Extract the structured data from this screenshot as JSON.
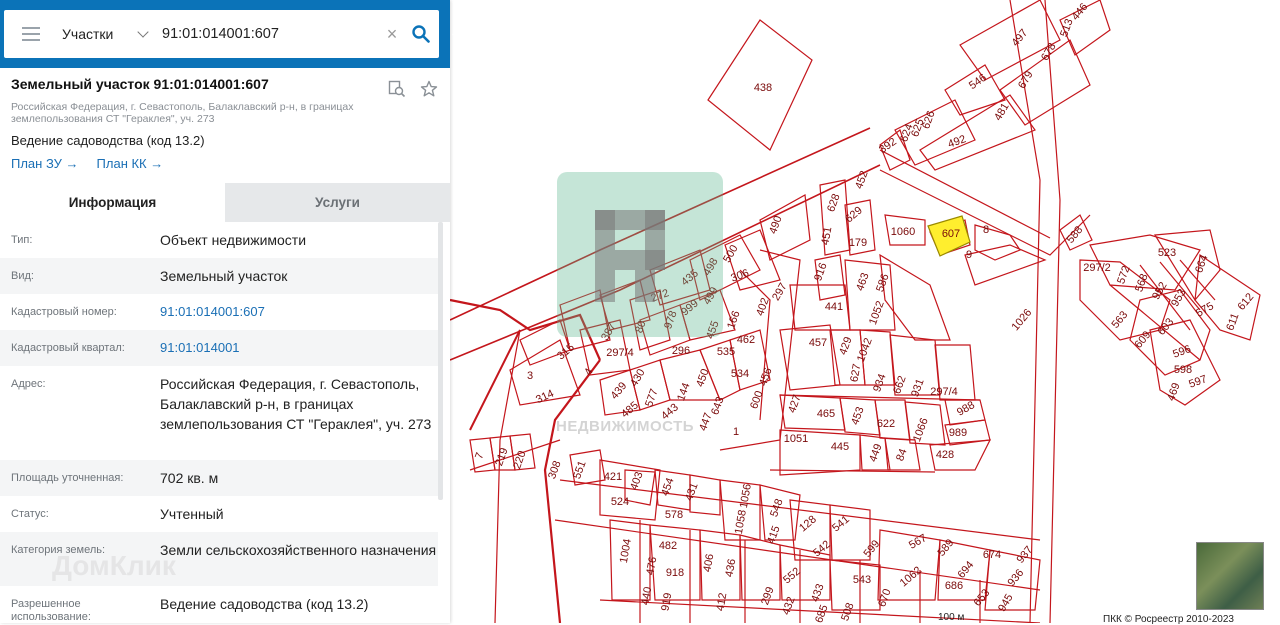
{
  "search": {
    "type_label": "Участки",
    "query": "91:01:014001:607",
    "clear_glyph": "×"
  },
  "card": {
    "title": "Земельный участок 91:01:014001:607",
    "address_short": "Российская Федерация, г. Севастополь, Балаклавский р-н, в границах землепользования СТ \"Гераклея\", уч. 273",
    "purpose": "Ведение садоводства (код 13.2)",
    "link_plan_zu": "План ЗУ →",
    "link_plan_kk": "План КК →"
  },
  "tabs": [
    {
      "label": "Информация",
      "active": true
    },
    {
      "label": "Услуги",
      "active": false
    }
  ],
  "info_rows": [
    {
      "key": "Тип:",
      "value": "Объект недвижимости"
    },
    {
      "key": "Вид:",
      "value": "Земельный участок"
    },
    {
      "key": "Кадастровый номер:",
      "value": "91:01:014001:607",
      "link": true
    },
    {
      "key": "Кадастровый квартал:",
      "value": "91:01:014001",
      "link": true
    },
    {
      "key": "Адрес:",
      "value": "Российская Федерация, г. Севастополь, Балаклавский р-н, в границах землепользования СТ \"Гераклея\", уч. 273"
    },
    {
      "key": "Площадь уточненная:",
      "value": "702 кв. м"
    },
    {
      "key": "Статус:",
      "value": "Учтенный"
    },
    {
      "key": "Категория земель:",
      "value": "Земли сельскохозяйственного назначения"
    },
    {
      "key": "Разрешенное использование:",
      "value": "Ведение садоводства (код 13.2)"
    }
  ],
  "map": {
    "selected_parcel": "607",
    "parcel_labels": [
      "438",
      "546",
      "492",
      "392",
      "624",
      "625",
      "626",
      "497",
      "513",
      "446",
      "481",
      "679",
      "678",
      "452",
      "628",
      "629",
      "451",
      "179",
      "1060",
      "607",
      "8",
      "9",
      "588",
      "523",
      "664",
      "612",
      "611",
      "575",
      "953",
      "952",
      "568",
      "572",
      "297/2",
      "563",
      "609",
      "603",
      "596",
      "598",
      "597",
      "469",
      "490",
      "500",
      "498",
      "435",
      "499",
      "306",
      "272",
      "999",
      "978",
      "387",
      "80",
      "297/4",
      "315",
      "3",
      "314",
      "296",
      "144",
      "450",
      "455",
      "535",
      "166",
      "462",
      "534",
      "456",
      "600",
      "643",
      "447",
      "1",
      "443",
      "485",
      "577",
      "439",
      "430",
      "4",
      "402",
      "297",
      "916",
      "463",
      "586",
      "441",
      "1052",
      "1026",
      "457",
      "429",
      "1042",
      "627",
      "934",
      "662",
      "931",
      "297/4",
      "988",
      "989",
      "427",
      "465",
      "453",
      "622",
      "1066",
      "1051",
      "445",
      "449",
      "84",
      "428",
      "7",
      "219",
      "220",
      "308",
      "551",
      "421",
      "403",
      "454",
      "431",
      "524",
      "578",
      "1056",
      "1058",
      "548",
      "415",
      "128",
      "541",
      "542",
      "567",
      "589",
      "674",
      "937",
      "936",
      "1004",
      "482",
      "476",
      "918",
      "440",
      "919",
      "406",
      "436",
      "412",
      "552",
      "433",
      "432",
      "685",
      "508",
      "599",
      "543",
      "670",
      "1062",
      "694",
      "686",
      "653",
      "945",
      "299"
    ],
    "scale_label": "100 м",
    "copyright": "ПКК © Росреестр 2010-2023"
  },
  "watermarks": {
    "rosreestr": "НЕДВИЖИМОСТЬ",
    "domclick": "ДомКлик"
  },
  "colors": {
    "brand": "#0b73b8",
    "parcel_stroke": "#c4161c",
    "parcel_selected": "#ffee2e",
    "link": "#1a6fb5"
  }
}
